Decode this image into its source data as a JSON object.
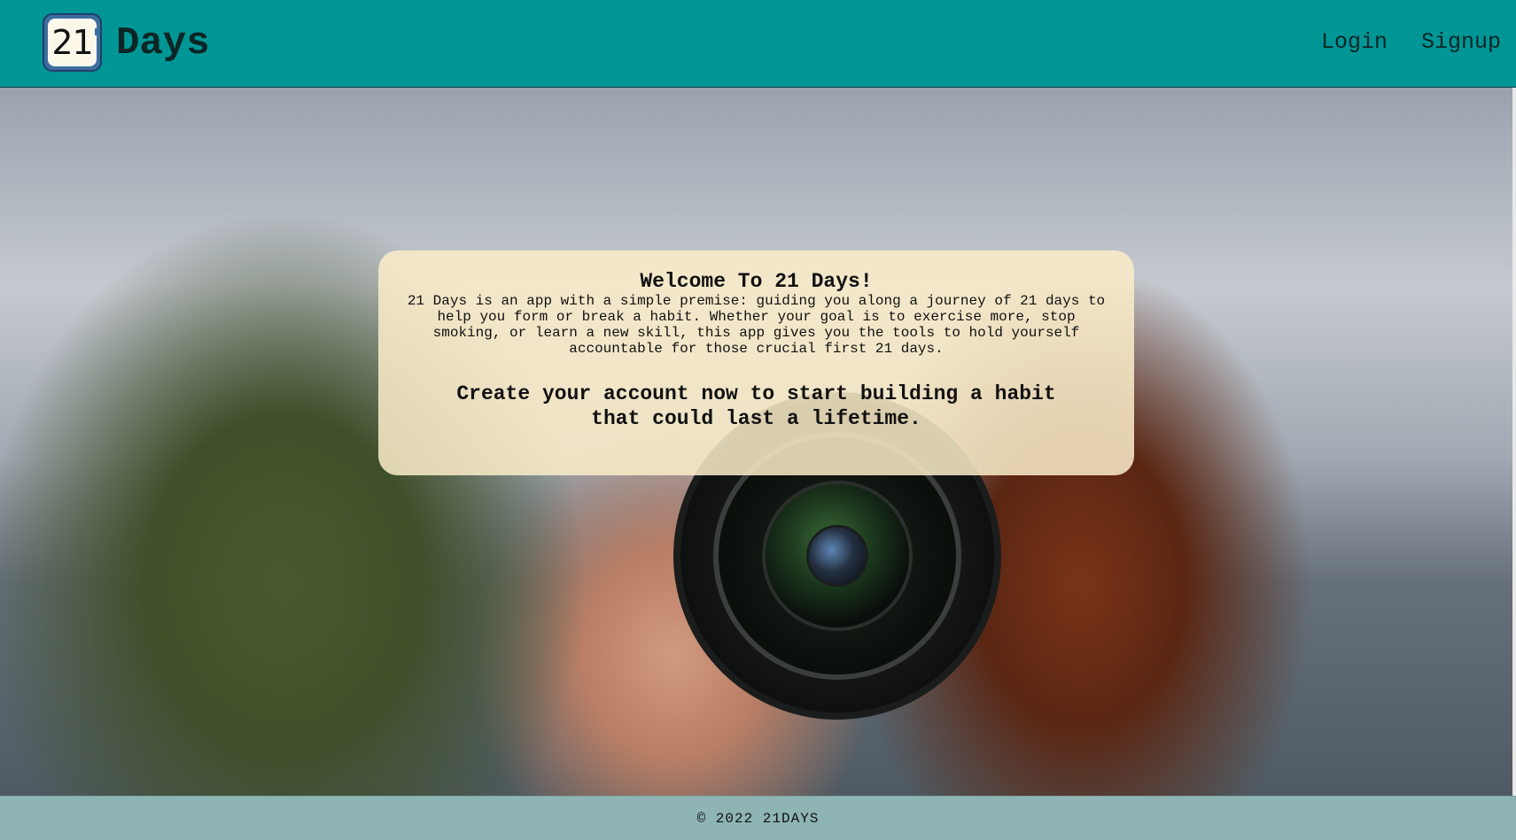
{
  "header": {
    "logo_icon_text": "21",
    "brand": "Days",
    "nav": {
      "login": "Login",
      "signup": "Signup"
    }
  },
  "welcome": {
    "title": "Welcome To 21 Days!",
    "description": "21 Days is an app with a simple premise: guiding you along a journey of 21 days to help you form or break a habit. Whether your goal is to exercise more, stop smoking, or learn a new skill, this app gives you the tools to hold yourself accountable for those crucial first 21 days.",
    "cta": "Create your account now to start building a habit that could last a lifetime."
  },
  "footer": {
    "copyright": "© 2022 21DAYS"
  },
  "colors": {
    "header_bg": "#019696",
    "footer_bg": "#8eb4b4",
    "card_bg": "#faecc8"
  },
  "icons": {
    "logo": "calendar-21-icon"
  }
}
